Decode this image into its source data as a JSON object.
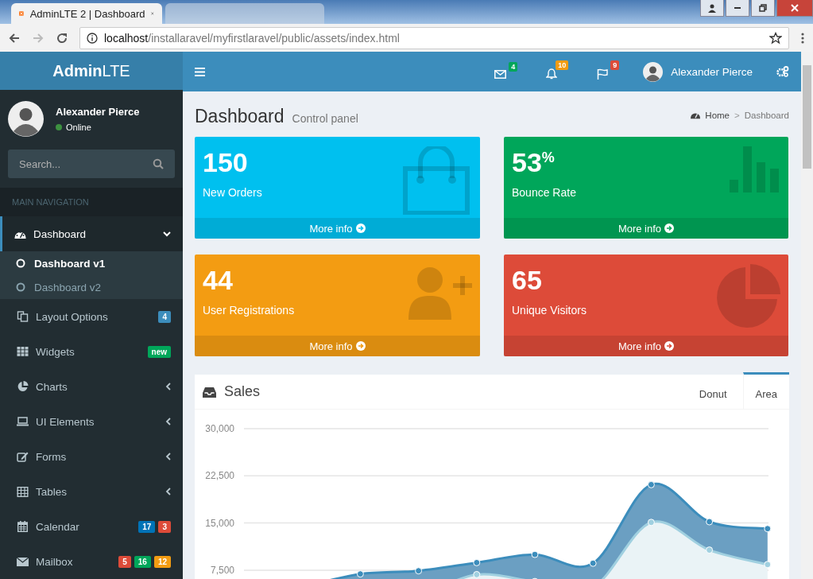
{
  "browser": {
    "tabs": [
      {
        "title": "AdminLTE 2 | Dashboard",
        "selected": true
      },
      {
        "selected": false
      }
    ],
    "url": {
      "host": "localhost",
      "path": "/installaravel/myfirstlaravel/public/assets/index.html"
    }
  },
  "header": {
    "brand_bold": "Admin",
    "brand_light": "LTE",
    "notifications": [
      {
        "count": "4",
        "color": "#00a65a"
      },
      {
        "count": "10",
        "color": "#f39c12"
      },
      {
        "count": "9",
        "color": "#dd4b39"
      }
    ],
    "user": "Alexander Pierce"
  },
  "sidebar": {
    "user": "Alexander Pierce",
    "status": "Online",
    "search_placeholder": "Search...",
    "nav_header": "MAIN NAVIGATION",
    "items": [
      {
        "label": "Dashboard",
        "selected": true,
        "expanded": true,
        "children": [
          {
            "label": "Dashboard v1",
            "selected": true
          },
          {
            "label": "Dashboard v2",
            "selected": false
          }
        ]
      },
      {
        "label": "Layout Options",
        "selected": false,
        "badges": [
          {
            "text": "4",
            "color": "#3c8dbc"
          }
        ]
      },
      {
        "label": "Widgets",
        "selected": false,
        "badges": [
          {
            "text": "new",
            "color": "#00a65a"
          }
        ]
      },
      {
        "label": "Charts",
        "selected": false,
        "expanded": false
      },
      {
        "label": "UI Elements",
        "selected": false,
        "expanded": false
      },
      {
        "label": "Forms",
        "selected": false,
        "expanded": false
      },
      {
        "label": "Tables",
        "selected": false,
        "expanded": false
      },
      {
        "label": "Calendar",
        "selected": false,
        "badges": [
          {
            "text": "17",
            "color": "#0073b7"
          },
          {
            "text": "3",
            "color": "#dd4b39"
          }
        ]
      },
      {
        "label": "Mailbox",
        "selected": false,
        "badges": [
          {
            "text": "5",
            "color": "#dd4b39"
          },
          {
            "text": "16",
            "color": "#00a65a"
          },
          {
            "text": "12",
            "color": "#f39c12"
          }
        ]
      }
    ]
  },
  "content": {
    "title": "Dashboard",
    "subtitle": "Control panel",
    "breadcrumb": [
      {
        "label": "Home"
      },
      {
        "label": "Dashboard"
      }
    ],
    "breadcrumb_separator": ">",
    "boxes": [
      {
        "value": "150",
        "label": "New Orders",
        "link": "More info",
        "color": "#00c0ef"
      },
      {
        "value": "53$^{%}$",
        "label": "Bounce Rate",
        "link": "More info",
        "color": "#00a65a"
      },
      {
        "value": "44",
        "label": "User Registrations",
        "link": "More info",
        "color": "#f39c12"
      },
      {
        "value": "65",
        "label": "Unique Visitors",
        "link": "More info",
        "color": "#dd4b39"
      }
    ],
    "sales": {
      "title": "Sales",
      "tabs": [
        {
          "label": "Donut",
          "selected": false
        },
        {
          "label": "Area",
          "selected": true
        }
      ],
      "chart_data": {
        "type": "area",
        "stacked": true,
        "grid": true,
        "ylim": [
          0,
          30000
        ],
        "yticks": [
          {
            "value": 7500,
            "label": "7,500"
          },
          {
            "value": 15000,
            "label": "15,000"
          },
          {
            "value": 22500,
            "label": "22,500"
          },
          {
            "value": 30000,
            "label": "30,000"
          }
        ],
        "series": [
          {
            "color": "#a0d0e0",
            "values": [
              2700,
              2800,
              4900,
              3800,
              6800,
              5700,
              4800,
              15100,
              10700,
              8400
            ]
          },
          {
            "color": "#3c8dbc",
            "values": [
              2700,
              2300,
              2000,
              3600,
              1900,
              4300,
              3800,
              6000,
              4500,
              5700
            ]
          }
        ]
      }
    }
  }
}
